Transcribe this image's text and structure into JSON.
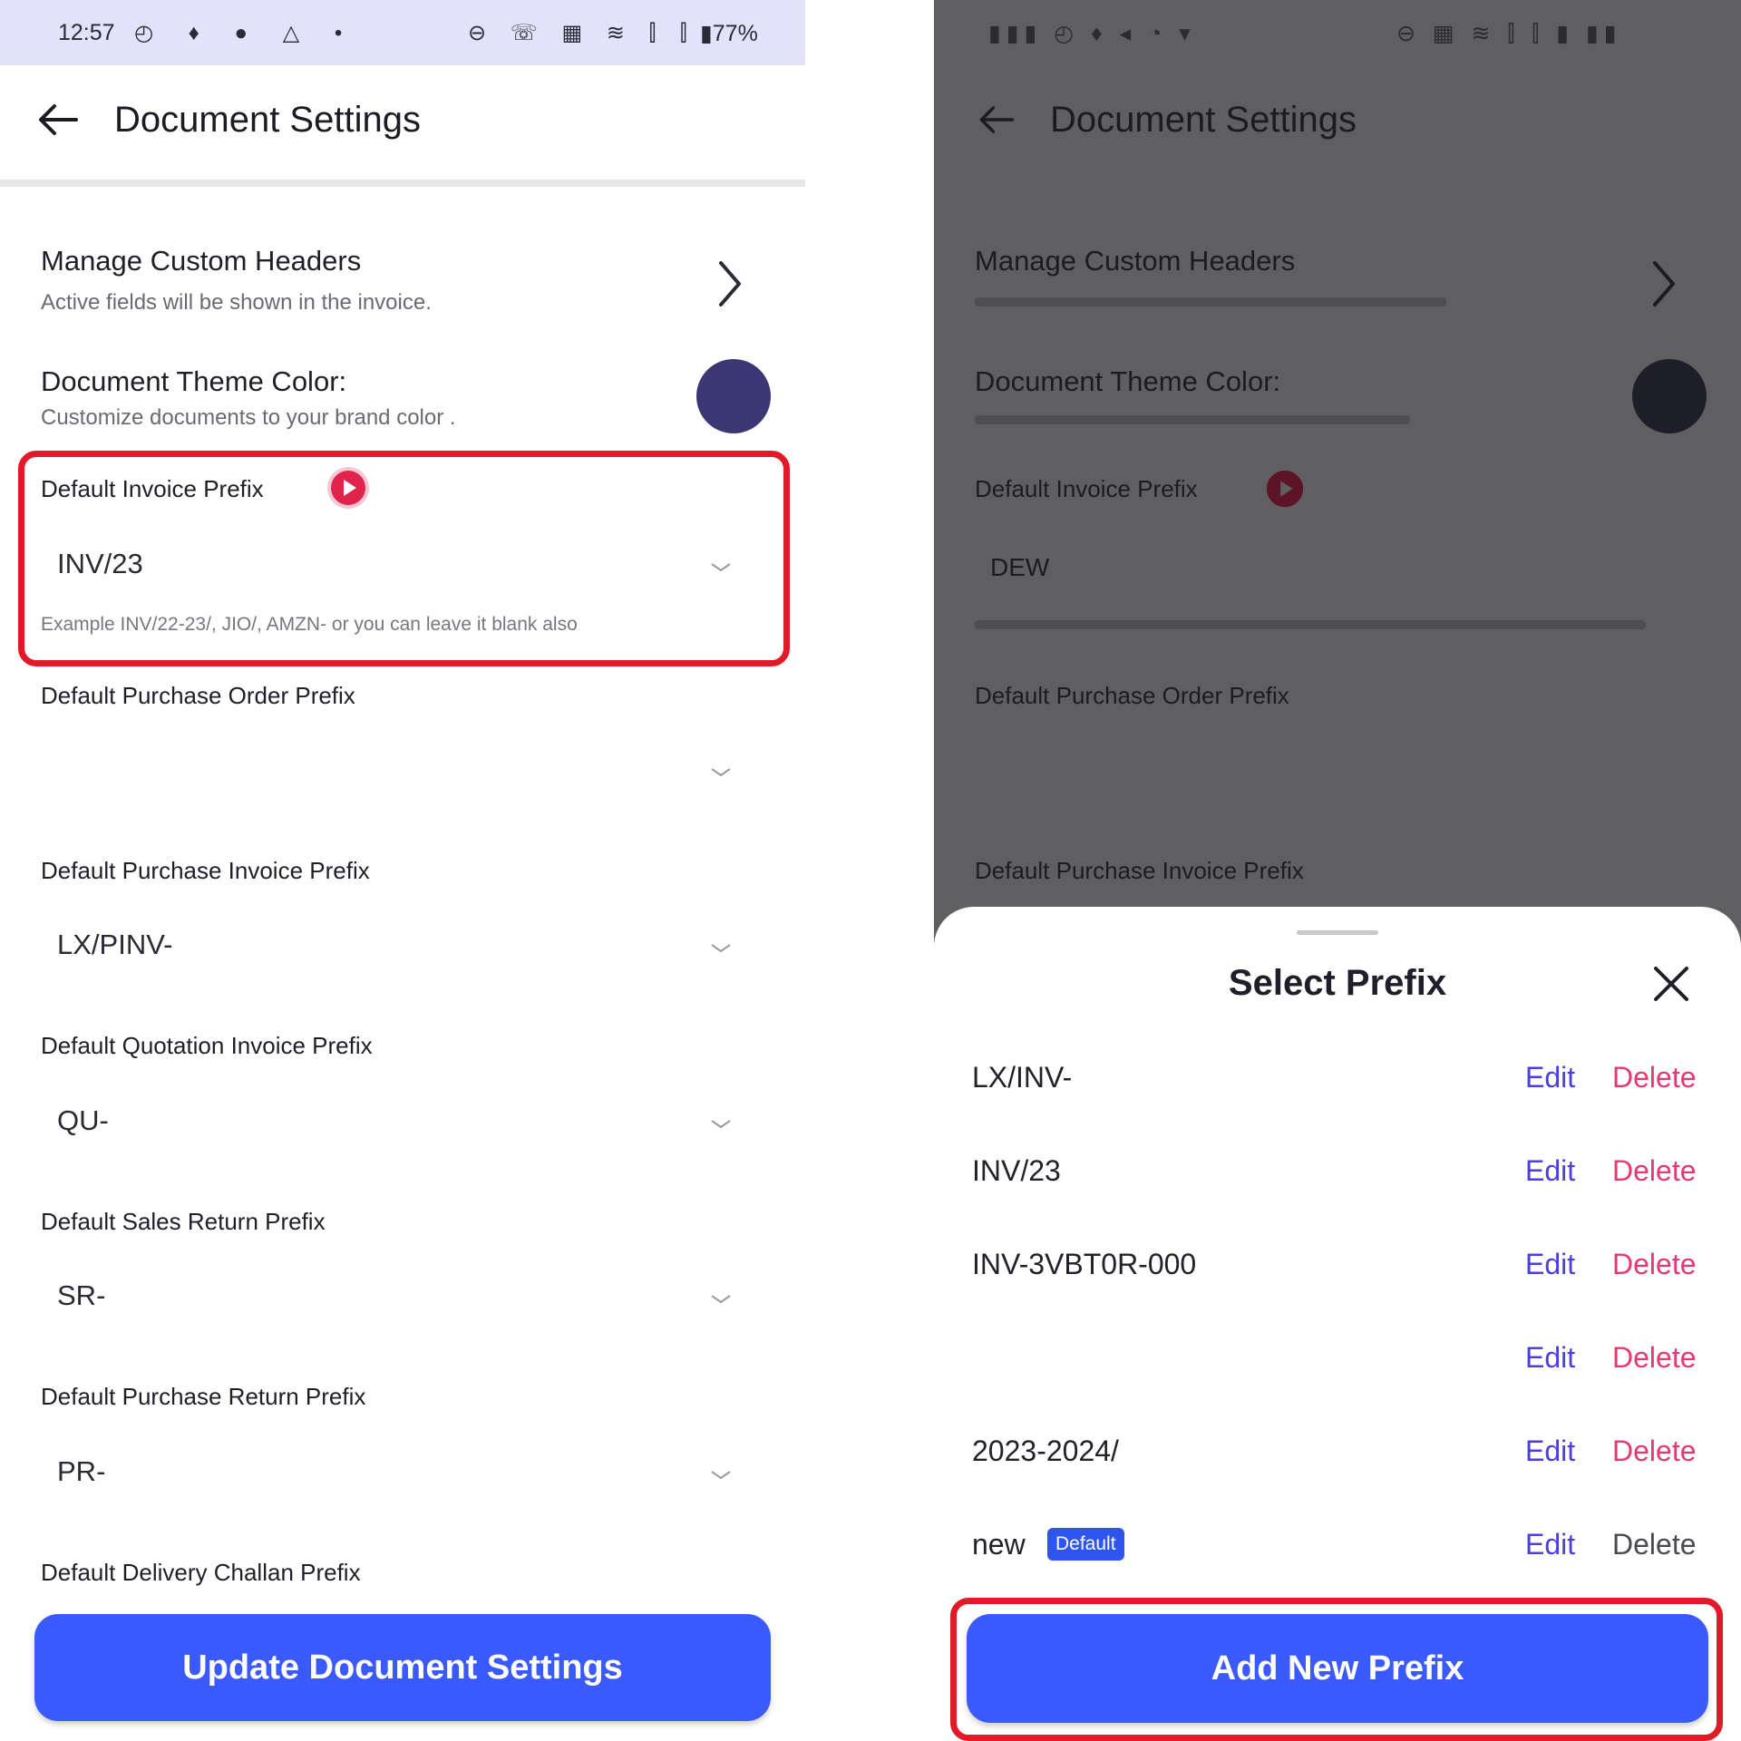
{
  "left": {
    "status": {
      "time": "12:57",
      "left_icons": "◴ ♦ ● △ •",
      "right_icons": "⊖ ☏ ▦ ≋ ⫿ ⫿",
      "battery": "▮77%"
    },
    "appbar": {
      "title": "Document Settings"
    },
    "custom_headers": {
      "title": "Manage Custom Headers",
      "subtitle": "Active fields will be shown in the invoice."
    },
    "theme_color": {
      "title": "Document Theme Color:",
      "subtitle": "Customize documents to your brand color .",
      "swatch": "#3b3775"
    },
    "invoice_prefix": {
      "label": "Default Invoice Prefix",
      "value": "INV/23",
      "helper": "Example INV/22-23/, JIO/, AMZN- or you can leave it blank also"
    },
    "purchase_order_prefix": {
      "label": "Default Purchase Order Prefix",
      "value": ""
    },
    "purchase_invoice_prefix": {
      "label": "Default Purchase Invoice Prefix",
      "value": "LX/PINV-"
    },
    "quotation_prefix": {
      "label": "Default Quotation Invoice Prefix",
      "value": "QU-"
    },
    "sales_return_prefix": {
      "label": "Default Sales Return Prefix",
      "value": "SR-"
    },
    "purchase_return_prefix": {
      "label": "Default Purchase Return Prefix",
      "value": "PR-"
    },
    "delivery_challan_prefix": {
      "label": "Default Delivery Challan Prefix"
    },
    "update_button": "Update Document Settings"
  },
  "right": {
    "appbar": {
      "title": "Document Settings"
    },
    "custom_headers_title": "Manage Custom Headers",
    "theme_color_title": "Document Theme Color:",
    "invoice_prefix_label": "Default Invoice Prefix",
    "invoice_prefix_value": "DEW",
    "purchase_order_label": "Default Purchase Order Prefix",
    "purchase_invoice_label": "Default Purchase Invoice Prefix",
    "sheet": {
      "title": "Select Prefix",
      "edit_label": "Edit",
      "delete_label": "Delete",
      "prefixes": [
        {
          "name": "LX/INV-"
        },
        {
          "name": "INV/23"
        },
        {
          "name": "INV-3VBT0R-000"
        },
        {
          "name": ""
        },
        {
          "name": "2023-2024/"
        },
        {
          "name": "new",
          "badge": "Default"
        }
      ],
      "add_button": "Add New Prefix"
    }
  },
  "colors": {
    "primary": "#3a5afe",
    "highlight": "#e01a28",
    "edit": "#4b3fe0",
    "delete": "#e43a6f",
    "play_icon": "#e0244c"
  }
}
